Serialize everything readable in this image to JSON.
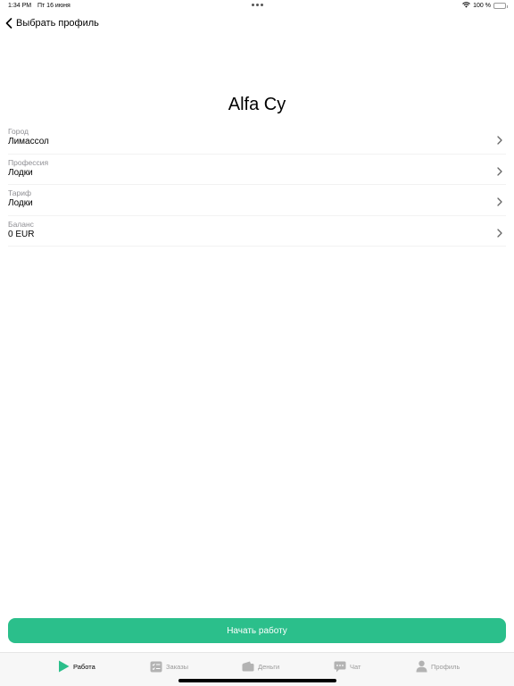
{
  "status_bar": {
    "time": "1:34 PM",
    "date": "Пт 16 июня",
    "battery": "100 %"
  },
  "nav": {
    "back_label": "Выбрать профиль"
  },
  "profile": {
    "name": "Alfa Cy"
  },
  "fields": [
    {
      "label": "Город",
      "value": "Лимассол"
    },
    {
      "label": "Профессия",
      "value": "Лодки"
    },
    {
      "label": "Тариф",
      "value": "Лодки"
    },
    {
      "label": "Баланс",
      "value": "0 EUR"
    }
  ],
  "start_button": {
    "label": "Начать работу"
  },
  "tabs": [
    {
      "label": "Работа",
      "icon": "play-icon",
      "active": true
    },
    {
      "label": "Заказы",
      "icon": "checklist-icon",
      "active": false
    },
    {
      "label": "Деньги",
      "icon": "wallet-icon",
      "active": false
    },
    {
      "label": "Чат",
      "icon": "chat-icon",
      "active": false
    },
    {
      "label": "Профиль",
      "icon": "person-icon",
      "active": false
    }
  ],
  "colors": {
    "accent": "#2bbf8b",
    "inactive_tab": "#9a9a9a",
    "secondary_label": "#8e8e93"
  }
}
